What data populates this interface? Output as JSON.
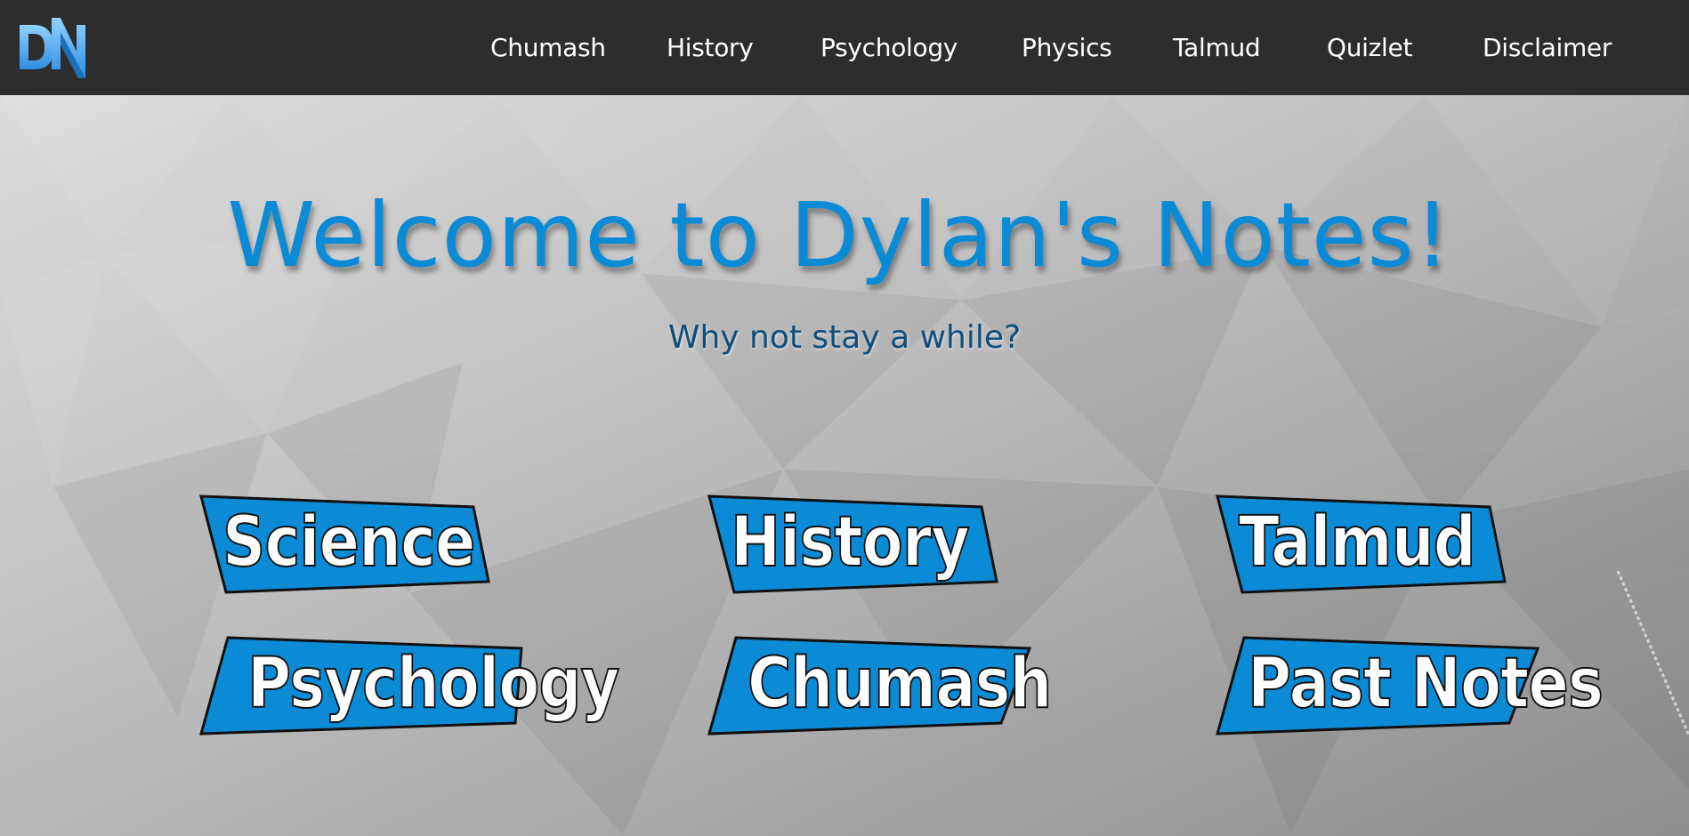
{
  "brand": {
    "logo_text": "DN"
  },
  "nav": {
    "items": [
      {
        "label": "Chumash"
      },
      {
        "label": "History"
      },
      {
        "label": "Psychology"
      },
      {
        "label": "Physics"
      },
      {
        "label": "Talmud"
      },
      {
        "label": "Quizlet"
      },
      {
        "label": "Disclaimer"
      }
    ]
  },
  "hero": {
    "title": "Welcome to Dylan's Notes!",
    "subtitle": "Why not stay a while?"
  },
  "categories": [
    {
      "label": "Science"
    },
    {
      "label": "History"
    },
    {
      "label": "Talmud"
    },
    {
      "label": "Psychology"
    },
    {
      "label": "Chumash"
    },
    {
      "label": "Past Notes"
    }
  ],
  "colors": {
    "header_bg": "#2d2d2d",
    "accent": "#0b8ad6",
    "subtitle": "#0f4e7a",
    "nav_text": "#ffffff"
  }
}
